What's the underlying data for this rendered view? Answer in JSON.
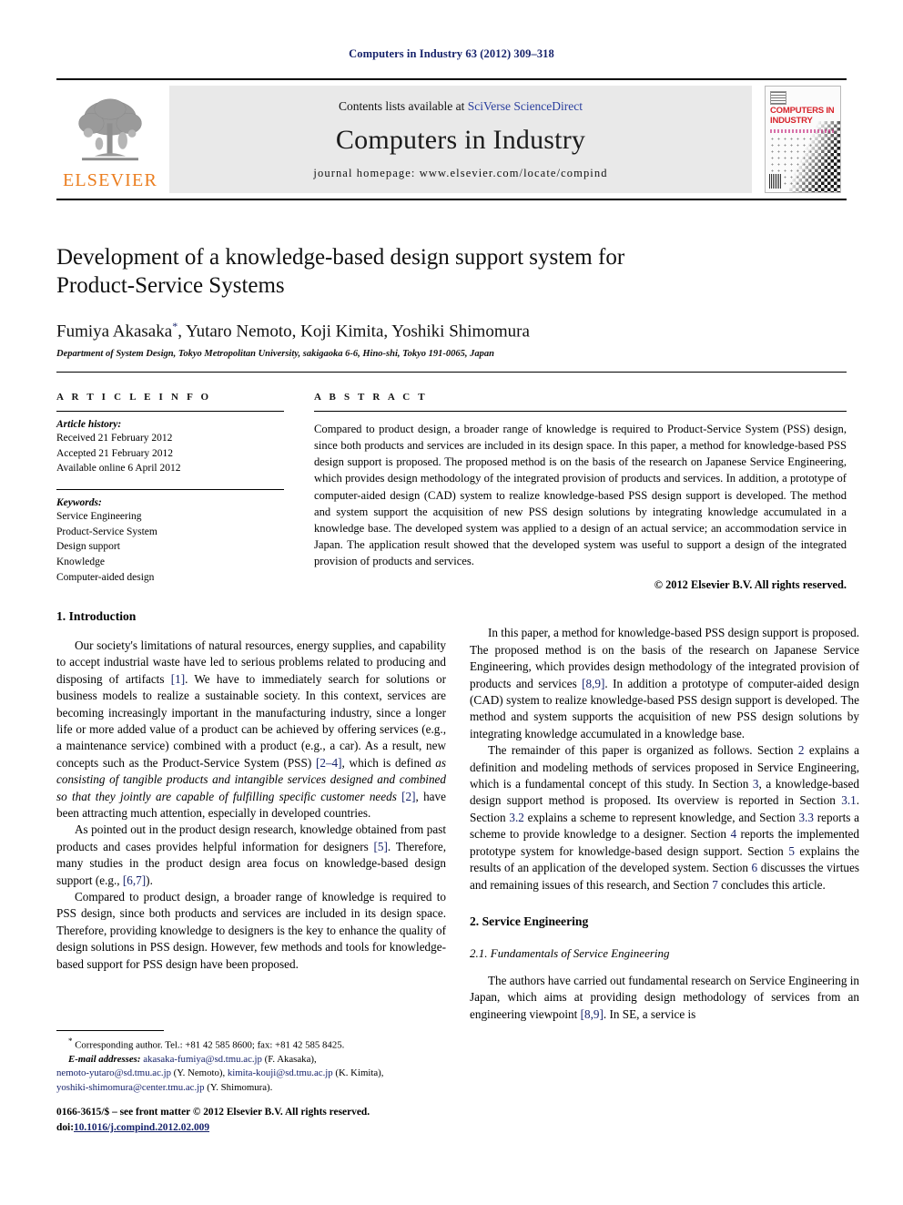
{
  "running_head": "Computers in Industry 63 (2012) 309–318",
  "masthead": {
    "contents_prefix": "Contents lists available at ",
    "contents_link": "SciVerse ScienceDirect",
    "journal_title": "Computers in Industry",
    "homepage": "journal homepage: www.elsevier.com/locate/compind",
    "publisher_name": "ELSEVIER",
    "cover_title": "COMPUTERS IN INDUSTRY",
    "link_color": "#2b3f9e",
    "cover_title_color": "#d7232b",
    "publisher_color": "#eb7d1e"
  },
  "title": "Development of a knowledge-based design support system for Product-Service Systems",
  "authors": "Fumiya Akasaka",
  "authors_rest": ", Yutaro Nemoto, Koji Kimita, Yoshiki Shimomura",
  "corresponding_marker": "*",
  "affiliation": "Department of System Design, Tokyo Metropolitan University, sakigaoka 6-6, Hino-shi, Tokyo 191-0065, Japan",
  "article_info": {
    "heading": "A R T I C L E  I N F O",
    "history_label": "Article history:",
    "history": [
      "Received 21 February 2012",
      "Accepted 21 February 2012",
      "Available online 6 April 2012"
    ],
    "keywords_label": "Keywords:",
    "keywords": [
      "Service Engineering",
      "Product-Service System",
      "Design support",
      "Knowledge",
      "Computer-aided design"
    ]
  },
  "abstract": {
    "heading": "A B S T R A C T",
    "text": "Compared to product design, a broader range of knowledge is required to Product-Service System (PSS) design, since both products and services are included in its design space. In this paper, a method for knowledge-based PSS design support is proposed. The proposed method is on the basis of the research on Japanese Service Engineering, which provides design methodology of the integrated provision of products and services. In addition, a prototype of computer-aided design (CAD) system to realize knowledge-based PSS design support is developed. The method and system support the acquisition of new PSS design solutions by integrating knowledge accumulated in a knowledge base. The developed system was applied to a design of an actual service; an accommodation service in Japan. The application result showed that the developed system was useful to support a design of the integrated provision of products and services.",
    "copyright": "© 2012 Elsevier B.V. All rights reserved."
  },
  "body": {
    "intro_heading": "1. Introduction",
    "intro_p1_a": "Our society's limitations of natural resources, energy supplies, and capability to accept industrial waste have led to serious problems related to producing and disposing of artifacts ",
    "intro_p1_ref1": "[1]",
    "intro_p1_b": ". We have to immediately search for solutions or business models to realize a sustainable society. In this context, services are becoming increasingly important in the manufacturing industry, since a longer life or more added value of a product can be achieved by offering services (e.g., a maintenance service) combined with a product (e.g., a car). As a result, new concepts such as the Product-Service System (PSS) ",
    "intro_p1_ref2": "[2–4]",
    "intro_p1_c": ", which is defined ",
    "intro_p1_italic": "as consisting of tangible products and intangible services designed and combined so that they jointly are capable of fulfilling specific customer needs ",
    "intro_p1_ref3": "[2]",
    "intro_p1_d": ", have been attracting much attention, especially in developed countries.",
    "intro_p2_a": "As pointed out in the product design research, knowledge obtained from past products and cases provides helpful information for designers ",
    "intro_p2_ref1": "[5]",
    "intro_p2_b": ". Therefore, many studies in the product design area focus on knowledge-based design support (e.g., ",
    "intro_p2_ref2": "[6,7]",
    "intro_p2_c": ").",
    "intro_p3": "Compared to product design, a broader range of knowledge is required to PSS design, since both products and services are included in its design space. Therefore, providing knowledge to designers is the key to enhance the quality of design solutions in PSS design. However, few methods and tools for knowledge-based support for PSS design have been proposed.",
    "intro_p4_a": "In this paper, a method for knowledge-based PSS design support is proposed. The proposed method is on the basis of the research on Japanese Service Engineering, which provides design methodology of the integrated provision of products and services ",
    "intro_p4_ref1": "[8,9]",
    "intro_p4_b": ". In addition a prototype of computer-aided design (CAD) system to realize knowledge-based PSS design support is developed. The method and system supports the acquisition of new PSS design solutions by integrating knowledge accumulated in a knowledge base.",
    "intro_p5_a": "The remainder of this paper is organized as follows. Section ",
    "intro_p5_s2": "2",
    "intro_p5_b": " explains a definition and modeling methods of services proposed in Service Engineering, which is a fundamental concept of this study. In Section ",
    "intro_p5_s3": "3",
    "intro_p5_c": ", a knowledge-based design support method is proposed. Its overview is reported in Section ",
    "intro_p5_s31": "3.1",
    "intro_p5_d": ". Section ",
    "intro_p5_s32": "3.2",
    "intro_p5_e": " explains a scheme to represent knowledge, and Section ",
    "intro_p5_s33": "3.3",
    "intro_p5_f": " reports a scheme to provide knowledge to a designer. Section ",
    "intro_p5_s4": "4",
    "intro_p5_g": " reports the implemented prototype system for knowledge-based design support. Section ",
    "intro_p5_s5": "5",
    "intro_p5_h": " explains the results of an application of the developed system. Section ",
    "intro_p5_s6": "6",
    "intro_p5_i": " discusses the virtues and remaining issues of this research, and Section ",
    "intro_p5_s7": "7",
    "intro_p5_j": " concludes this article.",
    "se_heading": "2. Service Engineering",
    "se_subheading": "2.1. Fundamentals of Service Engineering",
    "se_p1_a": "The authors have carried out fundamental research on Service Engineering in Japan, which aims at providing design methodology of services from an engineering viewpoint ",
    "se_p1_ref1": "[8,9]",
    "se_p1_b": ". In SE, a service is"
  },
  "footnote": {
    "star": "*",
    "corresponding": " Corresponding author. Tel.: +81 42 585 8600; fax: +81 42 585 8425.",
    "email_label": "E-mail addresses:",
    "email1": "akasaka-fumiya@sd.tmu.ac.jp",
    "email1_name": " (F. Akasaka),",
    "email2": "nemoto-yutaro@sd.tmu.ac.jp",
    "email2_name": " (Y. Nemoto),",
    "email3": "kimita-kouji@sd.tmu.ac.jp",
    "email3_name": " (K. Kimita),",
    "email4": "yoshiki-shimomura@center.tmu.ac.jp",
    "email4_name": " (Y. Shimomura)."
  },
  "colophon": {
    "line1": "0166-3615/$ – see front matter © 2012 Elsevier B.V. All rights reserved.",
    "doi_label": "doi:",
    "doi_value": "10.1016/j.compind.2012.02.009"
  }
}
